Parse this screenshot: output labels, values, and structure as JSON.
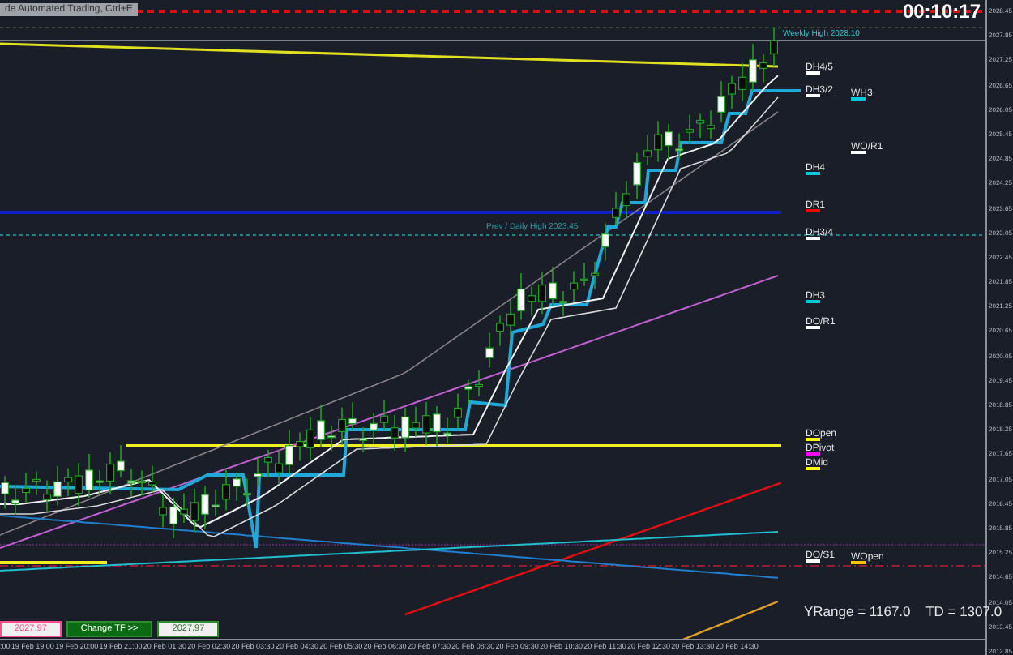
{
  "window": {
    "title": "de Automated Trading, Ctrl+E",
    "timer": "00:10:17"
  },
  "price_axis": [
    "2028.45",
    "2027.85",
    "2027.25",
    "2026.65",
    "2026.05",
    "2025.45",
    "2024.85",
    "2024.25",
    "2023.65",
    "2023.05",
    "2022.45",
    "2021.85",
    "2021.25",
    "2020.65",
    "2020.05",
    "2019.45",
    "2018.85",
    "2018.25",
    "2017.65",
    "2017.05",
    "2016.45",
    "2015.85",
    "2015.25",
    "2014.65",
    "2014.05",
    "2013.45",
    "2012.85"
  ],
  "time_axis": [
    ":00",
    "19 Feb 19:00",
    "19 Feb 20:00",
    "19 Feb 21:00",
    "20 Feb 01:30",
    "20 Feb 02:30",
    "20 Feb 03:30",
    "20 Feb 04:30",
    "20 Feb 05:30",
    "20 Feb 06:30",
    "20 Feb 07:30",
    "20 Feb 08:30",
    "20 Feb 09:30",
    "20 Feb 10:30",
    "20 Feb 11:30",
    "20 Feb 12:30",
    "20 Feb 13:30",
    "20 Feb 14:30"
  ],
  "levels": [
    {
      "label": "DH4/5",
      "color": "#ffffff"
    },
    {
      "label": "DH3/2",
      "color": "#ffffff"
    },
    {
      "label": "WH3",
      "color": "#00c8d8"
    },
    {
      "label": "WO/R1",
      "color": "#ffffff"
    },
    {
      "label": "DH4",
      "color": "#00c8d8"
    },
    {
      "label": "DR1",
      "color": "#ff0000"
    },
    {
      "label": "DH3/4",
      "color": "#ffffff"
    },
    {
      "label": "DH3",
      "color": "#00c8d8"
    },
    {
      "label": "DO/R1",
      "color": "#ffffff"
    },
    {
      "label": "DOpen",
      "color": "#ffff00"
    },
    {
      "label": "DPivot",
      "color": "#ff00ff"
    },
    {
      "label": "DMid",
      "color": "#ffff00"
    },
    {
      "label": "DO/S1",
      "color": "#ffffff"
    },
    {
      "label": "WOpen",
      "color": "#ffc000"
    }
  ],
  "chart_notes": [
    "Weekly High 2028.10",
    "Prev / Daily High 2023.45"
  ],
  "buttons": [
    {
      "label": "2027.97",
      "kind": "sell"
    },
    {
      "label": "Change TF >>",
      "kind": "action"
    },
    {
      "label": "2027.97",
      "kind": "buy"
    }
  ],
  "stats": "YRange = 1167.0    TD = 1307.0"
}
